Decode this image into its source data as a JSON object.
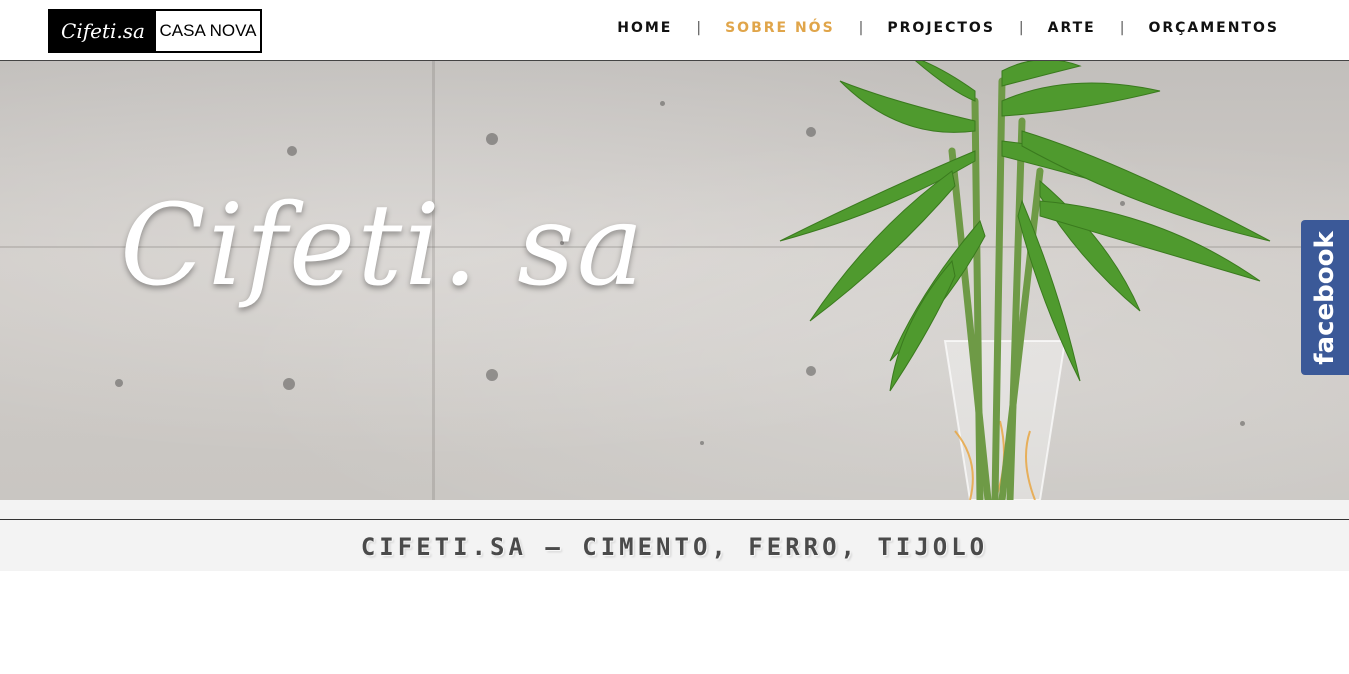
{
  "header": {
    "logo_script": "Cifeti.sa",
    "logo_text": "CASA NOVA",
    "nav": [
      {
        "label": "HOME",
        "active": false
      },
      {
        "label": "SOBRE NÓS",
        "active": true
      },
      {
        "label": "PROJECTOS",
        "active": false
      },
      {
        "label": "ARTE",
        "active": false
      },
      {
        "label": "ORÇAMENTOS",
        "active": false
      }
    ],
    "nav_separator": "|"
  },
  "hero": {
    "script_title": "Cifeti. sa"
  },
  "social": {
    "facebook_label": "facebook",
    "facebook_color": "#3b5998"
  },
  "tagline": {
    "text": "CIFETI.SA – CIMENTO, FERRO, TIJOLO"
  },
  "colors": {
    "accent": "#e0a54a",
    "nav_text": "#111111"
  }
}
